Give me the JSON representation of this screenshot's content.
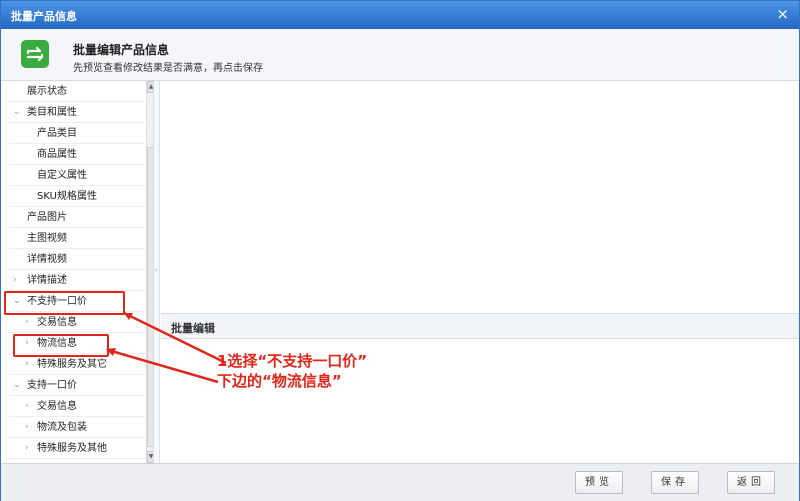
{
  "window": {
    "title": "批量产品信息",
    "close_glyph": "×"
  },
  "header": {
    "icon": "swap-arrows-icon",
    "title": "批量编辑产品信息",
    "subtitle": "先预览查看修改结果是否满意，再点击保存"
  },
  "sidebar": {
    "items": [
      {
        "label": "展示状态",
        "arrow": "",
        "indent": 0
      },
      {
        "label": "类目和属性",
        "arrow": "⌄",
        "indent": 0
      },
      {
        "label": "产品类目",
        "arrow": "",
        "indent": 1
      },
      {
        "label": "商品属性",
        "arrow": "",
        "indent": 1
      },
      {
        "label": "自定义属性",
        "arrow": "",
        "indent": 1
      },
      {
        "label": "SKU规格属性",
        "arrow": "",
        "indent": 1
      },
      {
        "label": "产品图片",
        "arrow": "",
        "indent": 0
      },
      {
        "label": "主图视频",
        "arrow": "",
        "indent": 0
      },
      {
        "label": "详情视频",
        "arrow": "",
        "indent": 0
      },
      {
        "label": "详情描述",
        "arrow": "›",
        "indent": 0
      },
      {
        "label": "不支持一口价",
        "arrow": "⌄",
        "indent": 0
      },
      {
        "label": "交易信息",
        "arrow": "›",
        "indent": 1
      },
      {
        "label": "物流信息",
        "arrow": "›",
        "indent": 1
      },
      {
        "label": "特殊服务及其它",
        "arrow": "›",
        "indent": 1
      },
      {
        "label": "支持一口价",
        "arrow": "⌄",
        "indent": 0
      },
      {
        "label": "交易信息",
        "arrow": "›",
        "indent": 1
      },
      {
        "label": "物流及包装",
        "arrow": "›",
        "indent": 1
      },
      {
        "label": "特殊服务及其他",
        "arrow": "›",
        "indent": 1
      }
    ]
  },
  "bulk_edit": {
    "title": "批量编辑"
  },
  "footer": {
    "preview_label": "预览",
    "save_label": "保存",
    "back_label": "返回"
  },
  "annotation": {
    "line1": "1选择“不支持一口价”",
    "line2": "下边的“物流信息”",
    "color": "#e0261a"
  },
  "colors": {
    "titlebar": "#2f74c8",
    "icon_green": "#3aab3e",
    "highlight": "#e0261a"
  }
}
